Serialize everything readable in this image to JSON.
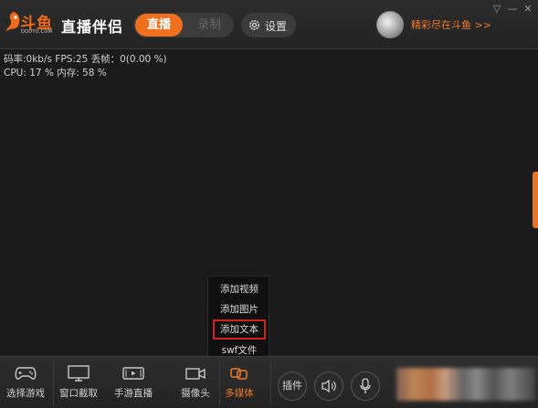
{
  "header": {
    "app_name": "直播伴侣",
    "logo_text": "斗鱼",
    "logo_sub": "DOUYU.COM",
    "tabs": [
      {
        "label": "直播",
        "active": true
      },
      {
        "label": "录制",
        "active": false
      }
    ],
    "settings_label": "设置",
    "promo_text": "精彩尽在斗鱼 >>"
  },
  "stats": {
    "line1": "码率:0kb/s   FPS:25  丢帧：0(0.00 %)",
    "line2": "CPU: 17 %    内存: 58 %"
  },
  "popup_menu": {
    "items": [
      {
        "label": "添加视频",
        "selected": false
      },
      {
        "label": "添加图片",
        "selected": false
      },
      {
        "label": "添加文本",
        "selected": true
      },
      {
        "label": "swf文件",
        "selected": false
      }
    ]
  },
  "toolbar": {
    "tools": [
      {
        "label": "选择游戏",
        "icon": "gamepad-icon"
      },
      {
        "label": "窗口截取",
        "icon": "monitor-icon"
      },
      {
        "label": "手游直播",
        "icon": "phone-landscape-icon"
      },
      {
        "label": "摄像头",
        "icon": "camera-icon"
      },
      {
        "label": "多媒体",
        "icon": "multimedia-icon",
        "active": true
      }
    ],
    "plugin_label": "插件"
  },
  "colors": {
    "accent": "#f07020",
    "background": "#1b1b1b",
    "highlight_border": "#d42323"
  }
}
